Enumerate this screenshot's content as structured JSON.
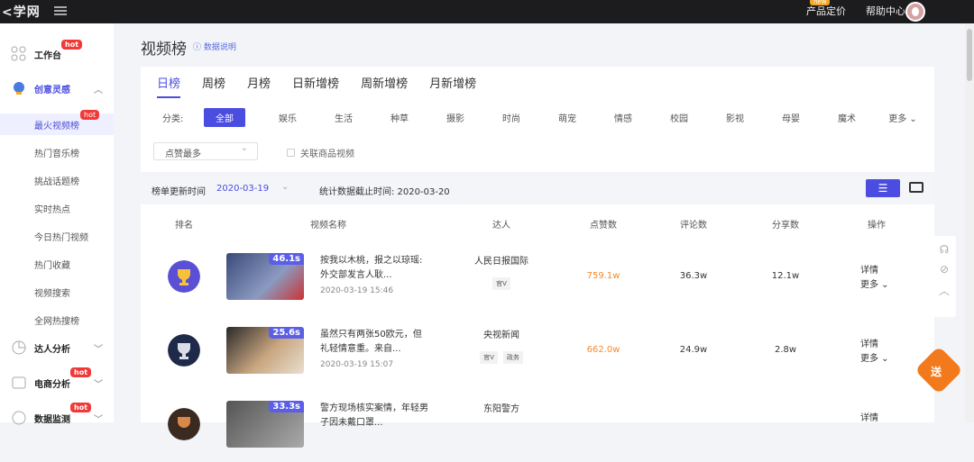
{
  "topbar": {
    "logo": "<学网",
    "pricing": "产品定价",
    "new_badge": "new",
    "help": "帮助中心"
  },
  "sidebar": {
    "workbench": "工作台",
    "workbench_badge": "hot",
    "creative": "创意灵感",
    "items": [
      {
        "label": "最火视频榜",
        "badge": "hot"
      },
      {
        "label": "热门音乐榜"
      },
      {
        "label": "挑战话题榜"
      },
      {
        "label": "实时热点"
      },
      {
        "label": "今日热门视频"
      },
      {
        "label": "热门收藏"
      },
      {
        "label": "视频搜索"
      },
      {
        "label": "全网热搜榜"
      }
    ],
    "talent": "达人分析",
    "ecommerce": "电商分析",
    "ecommerce_badge": "hot",
    "monitor": "数据监测",
    "monitor_badge": "hot"
  },
  "page": {
    "title": "视频榜",
    "note": "ⓘ 数据说明"
  },
  "tabs": [
    "日榜",
    "周榜",
    "月榜",
    "日新增榜",
    "周新增榜",
    "月新增榜"
  ],
  "categories": {
    "label": "分类:",
    "items": [
      "全部",
      "娱乐",
      "生活",
      "种草",
      "摄影",
      "时尚",
      "萌宠",
      "情感",
      "校园",
      "影视",
      "母婴",
      "魔术",
      "更多"
    ]
  },
  "filters": {
    "sort": "点赞最多",
    "related": "关联商品视频"
  },
  "meta": {
    "update_label": "榜单更新时间",
    "update_date": "2020-03-19",
    "cutoff": "统计数据截止时间: 2020-03-20"
  },
  "table": {
    "headers": [
      "排名",
      "视频名称",
      "达人",
      "点赞数",
      "评论数",
      "分享数",
      "操作"
    ],
    "rows": [
      {
        "duration": "46.1s",
        "title": "按我以木桃，报之以琼瑶: 外交部发言人耿...",
        "time": "2020-03-19 15:46",
        "author": "人民日报国际",
        "tags": [
          "官V"
        ],
        "likes": "759.1w",
        "comments": "36.3w",
        "shares": "12.1w",
        "op1": "详情",
        "op2": "更多 ⌄"
      },
      {
        "duration": "25.6s",
        "title": "虽然只有两张50欧元，但礼轻情意重。来自...",
        "time": "2020-03-19 15:07",
        "author": "央视新闻",
        "tags": [
          "官V",
          "政务"
        ],
        "likes": "662.0w",
        "comments": "24.9w",
        "shares": "2.8w",
        "op1": "详情",
        "op2": "更多 ⌄"
      },
      {
        "duration": "33.3s",
        "title": "警方现场核实案情，年轻男子因未戴口罩...",
        "time": "",
        "author": "东阳警方",
        "tags": [],
        "likes": "",
        "comments": "",
        "shares": "",
        "op1": "详情",
        "op2": ""
      }
    ]
  },
  "gift": "送",
  "colors": {
    "accent": "#4a4de0",
    "hot": "#f03a3a",
    "likes": "#f58a2a"
  }
}
